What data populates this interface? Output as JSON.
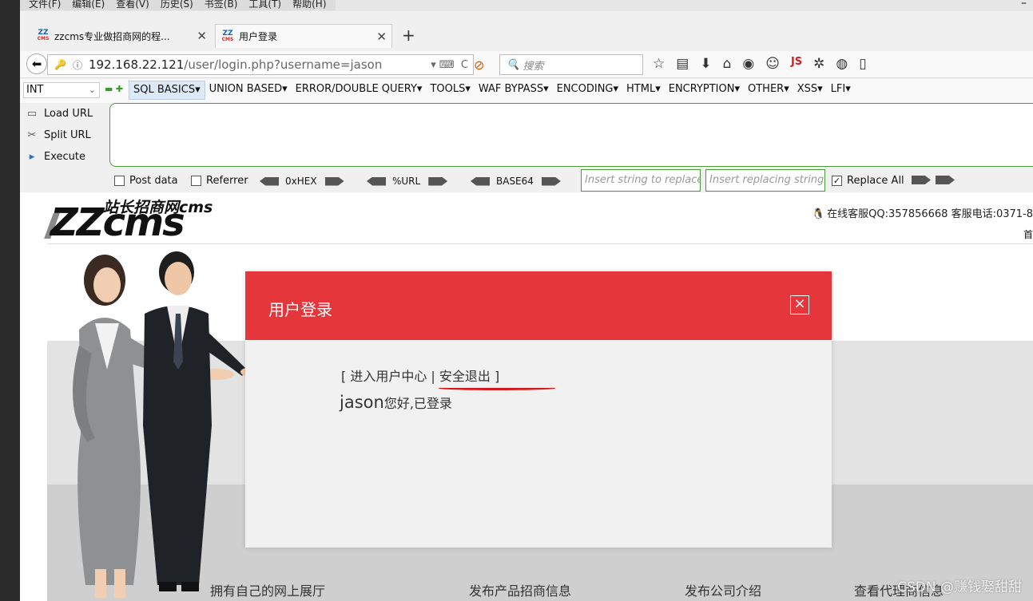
{
  "menubar": {
    "items": [
      "文件(F)",
      "编辑(E)",
      "查看(V)",
      "历史(S)",
      "书签(B)",
      "工具(T)",
      "帮助(H)"
    ],
    "minimize": "–"
  },
  "tabs": [
    {
      "label": "zzcms专业做招商网的程...",
      "favicon": "ZZ"
    },
    {
      "label": "用户登录",
      "favicon": "ZZ"
    }
  ],
  "newtab": "+",
  "navbar": {
    "url_host": "192.168.22.121",
    "url_path": "/user/login.php?username=jason",
    "search_placeholder": "搜索",
    "js_label": "JS"
  },
  "hackbar": {
    "type_select": "INT",
    "menus": [
      "SQL BASICS▾",
      "UNION BASED▾",
      "ERROR/DOUBLE QUERY▾",
      "TOOLS▾",
      "WAF BYPASS▾",
      "ENCODING▾",
      "HTML▾",
      "ENCRYPTION▾",
      "OTHER▾",
      "XSS▾",
      "LFI▾"
    ],
    "load_url": "Load URL",
    "split_url": "Split URL",
    "execute": "Execute",
    "post_data": "Post data",
    "referrer": "Referrer",
    "hex": "0xHEX",
    "urlenc": "%URL",
    "base64": "BASE64",
    "insert_replace": "Insert string to replace",
    "insert_replacing": "Insert replacing string",
    "replace_all": "Replace All"
  },
  "page": {
    "logo_cn": "站长招商网cms",
    "logo_en": "ZZcms",
    "top_info": "在线客服QQ:357856668 客服电话:0371-8",
    "tiny": "首",
    "bottom_nav": [
      "拥有自己的网上展厅",
      "发布产品招商信息",
      "发布公司介绍",
      "查看代理商信息"
    ],
    "watermark": "CSDN @赚钱娶甜甜"
  },
  "modal": {
    "title": "用户登录",
    "close": "×",
    "link_open": "[ ",
    "link_center": "进入用户中心",
    "link_sep": " | ",
    "link_logout": "安全退出",
    "link_close": " ]",
    "username": "jason",
    "message": "您好,已登录"
  },
  "colors": {
    "modal_header": "#e5363b",
    "hackbar_border": "#4a9a3a",
    "annotation": "#d41a1a"
  }
}
